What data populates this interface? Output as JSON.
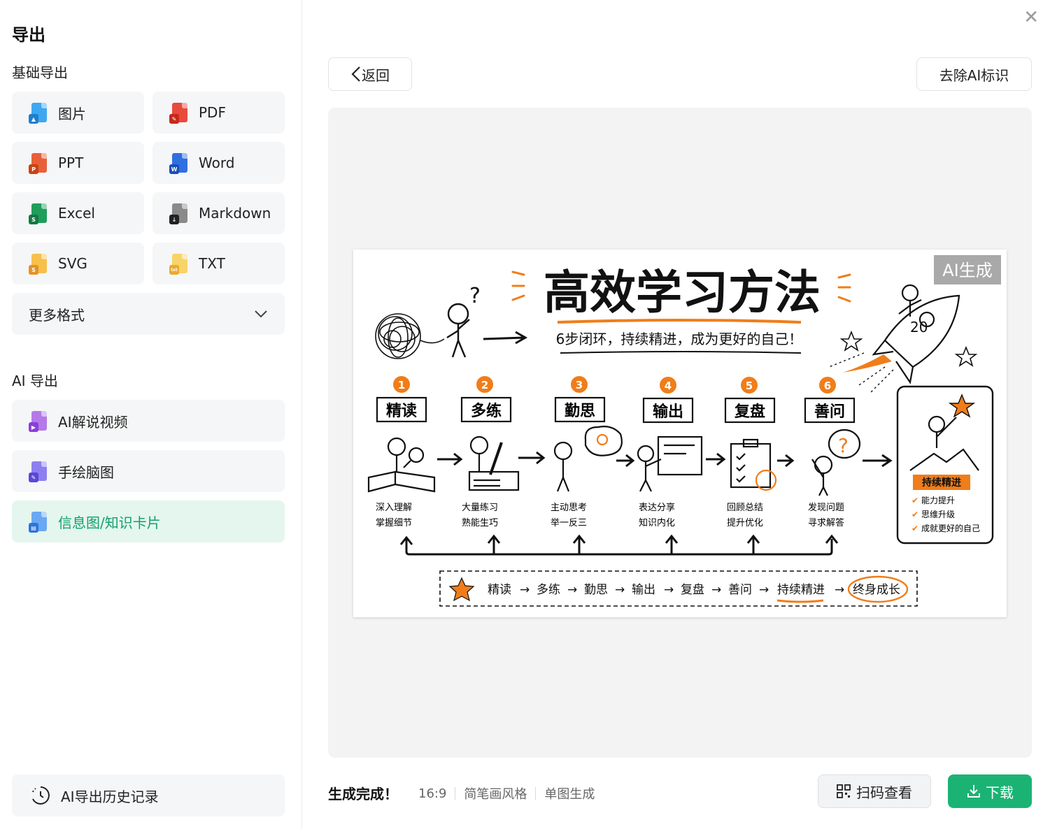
{
  "sidebar": {
    "title": "导出",
    "basic_section": "基础导出",
    "basic_formats": [
      {
        "label": "图片",
        "icon": "image-file-icon",
        "color": "#3fa7f0"
      },
      {
        "label": "PDF",
        "icon": "pdf-file-icon",
        "color": "#e84b3c"
      },
      {
        "label": "PPT",
        "icon": "ppt-file-icon",
        "color": "#e8603a"
      },
      {
        "label": "Word",
        "icon": "word-file-icon",
        "color": "#2f6fe0"
      },
      {
        "label": "Excel",
        "icon": "excel-file-icon",
        "color": "#1f9d5b"
      },
      {
        "label": "Markdown",
        "icon": "markdown-file-icon",
        "color": "#444444"
      },
      {
        "label": "SVG",
        "icon": "svg-file-icon",
        "color": "#f0a534"
      },
      {
        "label": "TXT",
        "icon": "txt-file-icon",
        "color": "#f4c34a"
      }
    ],
    "more_formats": "更多格式",
    "ai_section": "AI 导出",
    "ai_items": [
      {
        "label": "AI解说视频",
        "icon": "video-file-icon",
        "color": "#a45be6",
        "active": false
      },
      {
        "label": "手绘脑图",
        "icon": "mindmap-file-icon",
        "color": "#6b5be6",
        "active": false
      },
      {
        "label": "信息图/知识卡片",
        "icon": "infographic-file-icon",
        "color": "#3f8ef0",
        "active": true
      }
    ],
    "history": "AI导出历史记录"
  },
  "toolbar": {
    "back_label": "返回",
    "remove_ai_label": "去除AI标识"
  },
  "poster": {
    "title": "高效学习方法",
    "subtitle": "6步闭环，持续精进，成为更好的自己！",
    "watermark": "AI生成",
    "steps": [
      {
        "num": "1",
        "name": "精读",
        "b1": "深入理解",
        "b2": "掌握细节"
      },
      {
        "num": "2",
        "name": "多练",
        "b1": "大量练习",
        "b2": "熟能生巧"
      },
      {
        "num": "3",
        "name": "勤思",
        "b1": "主动思考",
        "b2": "举一反三"
      },
      {
        "num": "4",
        "name": "输出",
        "b1": "表达分享",
        "b2": "知识内化"
      },
      {
        "num": "5",
        "name": "复盘",
        "b1": "回顾总结",
        "b2": "提升优化"
      },
      {
        "num": "6",
        "name": "善问",
        "b1": "发现问题",
        "b2": "寻求解答"
      }
    ],
    "goal_title": "持续精进",
    "goal_items": [
      "能力提升",
      "思维升级",
      "成就更好的自己"
    ],
    "flow": [
      "精读",
      "多练",
      "勤思",
      "输出",
      "复盘",
      "善问",
      "持续精进",
      "终身成长"
    ],
    "rocket_text": "20",
    "question_mark": "?",
    "accent": "#f07d1a"
  },
  "footer": {
    "status": "生成完成！",
    "ratio": "16:9",
    "style": "简笔画风格",
    "mode": "单图生成",
    "scan_label": "扫码查看",
    "download_label": "下载"
  }
}
